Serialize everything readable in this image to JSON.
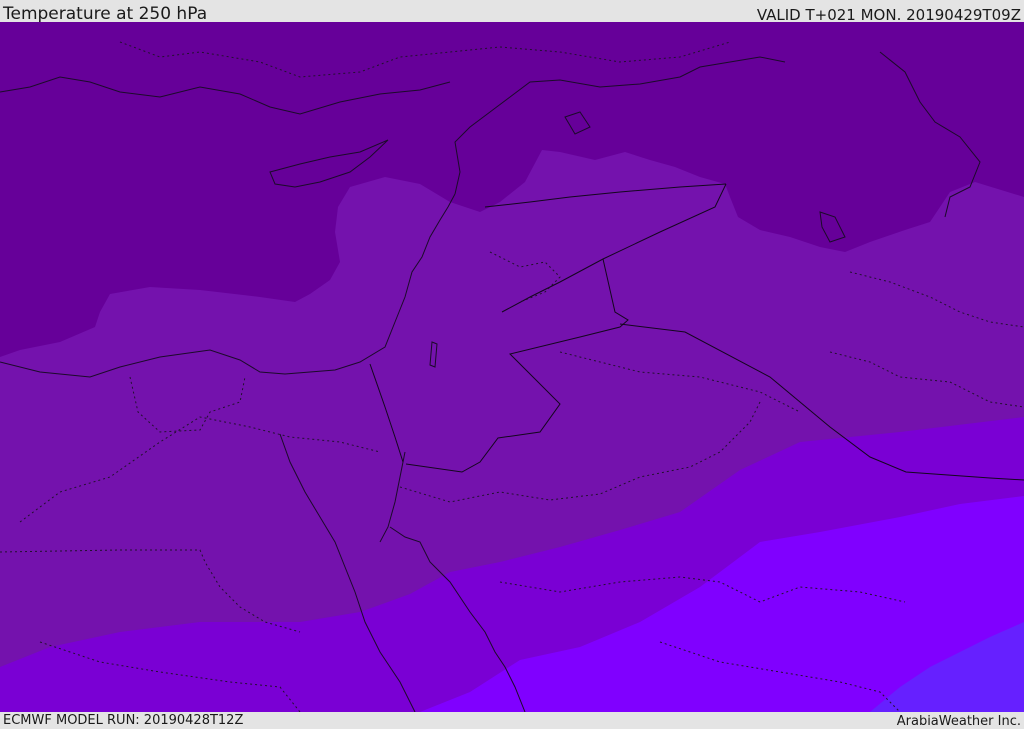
{
  "header": {
    "title": "Temperature at 250 hPa",
    "valid": "VALID T+021 MON. 20190429T09Z"
  },
  "footer": {
    "model_run": "ECMWF MODEL RUN: 20190428T12Z",
    "provider": "ArabiaWeather Inc."
  },
  "colors": {
    "band_coldest": "#660099",
    "band_cold": "#7412ad",
    "band_mid": "#7a00d4",
    "band_warm": "#8000ff",
    "band_warmest": "#6620ff"
  }
}
